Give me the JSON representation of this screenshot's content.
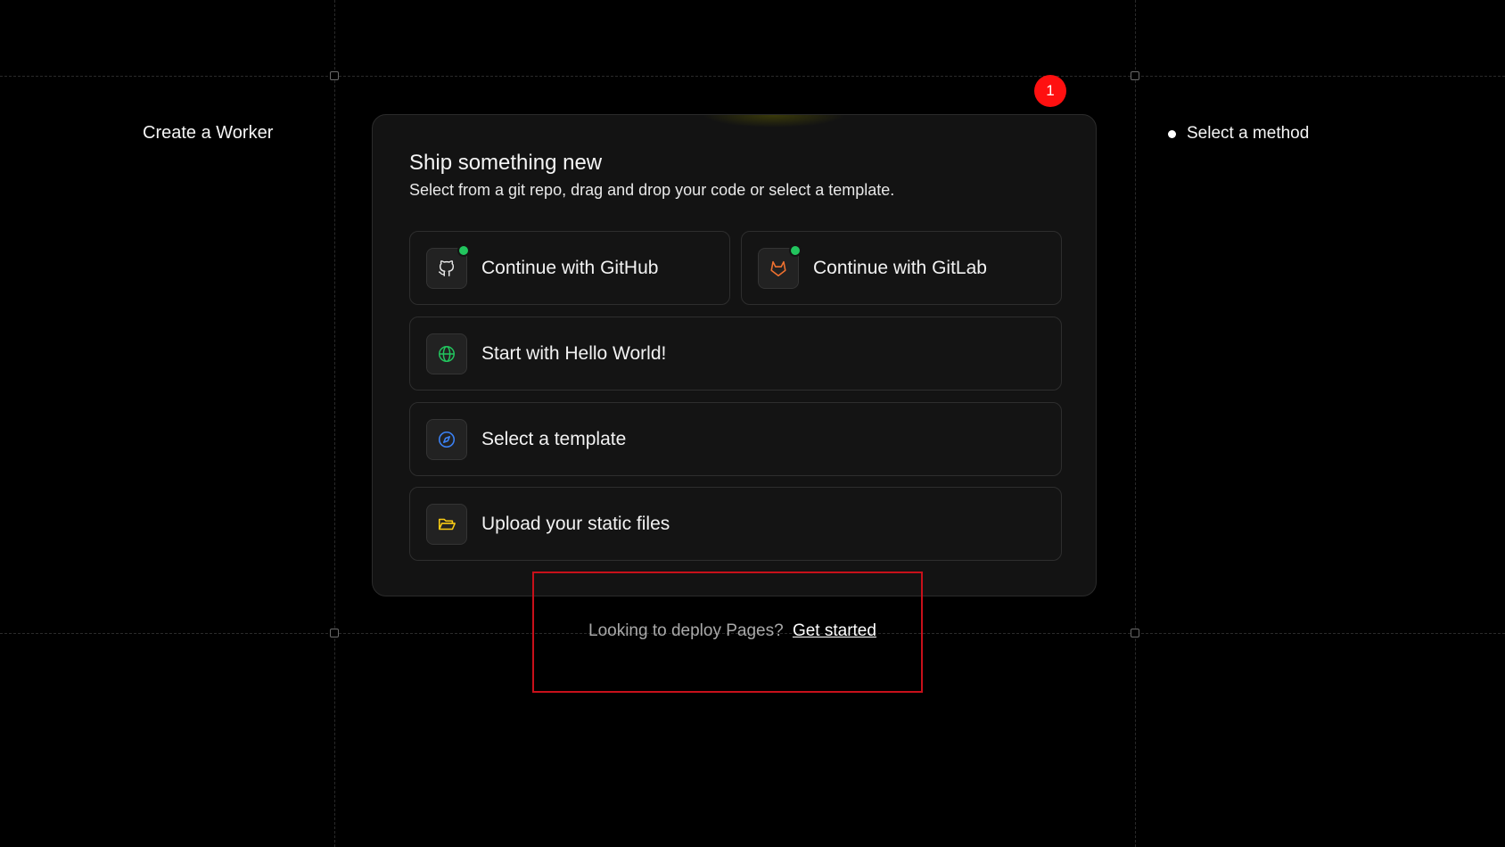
{
  "page": {
    "left_title": "Create a Worker",
    "steps": [
      {
        "label": "Select a method"
      }
    ]
  },
  "card": {
    "title": "Ship something new",
    "subtitle": "Select from a git repo, drag and drop your code or select a template.",
    "options": [
      {
        "label": "Continue with GitHub",
        "icon": "github-icon",
        "connected": true
      },
      {
        "label": "Continue with GitLab",
        "icon": "gitlab-icon",
        "connected": true
      },
      {
        "label": "Start with Hello World!",
        "icon": "globe-icon"
      },
      {
        "label": "Select a template",
        "icon": "compass-icon"
      },
      {
        "label": "Upload your static files",
        "icon": "folder-icon"
      }
    ]
  },
  "footer": {
    "text": "Looking to deploy Pages?",
    "link_label": "Get started"
  },
  "annotation": {
    "badge_number": "1"
  },
  "colors": {
    "background": "#000000",
    "card": "#131313",
    "status_green": "#22c55e",
    "gitlab_orange": "#f0712f",
    "globe_green": "#22c55e",
    "compass_blue": "#3b82f6",
    "folder_yellow": "#facc15",
    "annotation_red": "#ff1010"
  }
}
